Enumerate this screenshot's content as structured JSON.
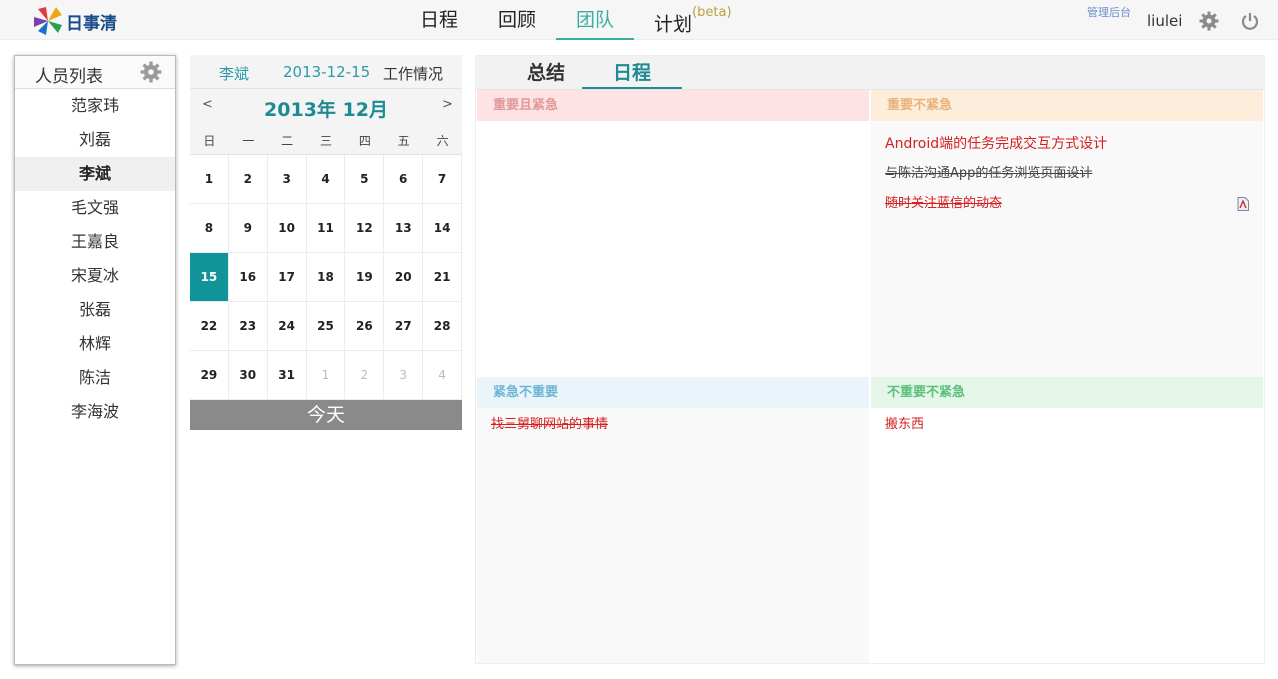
{
  "brand": {
    "logo_text": "日事清"
  },
  "nav": {
    "items": [
      {
        "label": "日程"
      },
      {
        "label": "回顾"
      },
      {
        "label": "团队"
      },
      {
        "label": "计划"
      }
    ],
    "beta_label": "(beta)",
    "active_index": 2
  },
  "user": {
    "admin_link": "管理后台",
    "username": "liulei"
  },
  "people": {
    "title": "人员列表",
    "members": [
      "范家玮",
      "刘磊",
      "李斌",
      "毛文强",
      "王嘉良",
      "宋夏冰",
      "张磊",
      "林辉",
      "陈洁",
      "李海波"
    ],
    "selected": "李斌"
  },
  "calendar": {
    "person": "李斌",
    "date": "2013-12-15",
    "work_label": "工作情况",
    "prev": "<",
    "next": ">",
    "month_label": "2013年 12月",
    "weekdays": [
      "日",
      "一",
      "二",
      "三",
      "四",
      "五",
      "六"
    ],
    "days": [
      "1",
      "2",
      "3",
      "4",
      "5",
      "6",
      "7",
      "8",
      "9",
      "10",
      "11",
      "12",
      "13",
      "14",
      "15",
      "16",
      "17",
      "18",
      "19",
      "20",
      "21",
      "22",
      "23",
      "24",
      "25",
      "26",
      "27",
      "28",
      "29",
      "30",
      "31",
      "1",
      "2",
      "3",
      "4"
    ],
    "selected_day": "15",
    "today_button": "今天"
  },
  "panel": {
    "tabs": {
      "summary": "总结",
      "schedule": "日程"
    },
    "quadrants": {
      "important_urgent": {
        "title": "重要且紧急",
        "tasks": []
      },
      "important_not_urgent": {
        "title": "重要不紧急",
        "tasks": [
          {
            "text": "Android端的任务完成交互方式设计"
          },
          {
            "text": "与陈洁沟通App的任务浏览页面设计"
          },
          {
            "text": "随时关注蓝信的动态"
          }
        ]
      },
      "urgent_not_important": {
        "title": "紧急不重要",
        "tasks": [
          {
            "text": "找三舅聊网站的事情"
          }
        ]
      },
      "not_important_not_urgent": {
        "title": "不重要不紧急",
        "tasks": [
          {
            "text": "搬东西"
          }
        ]
      }
    }
  },
  "colors": {
    "accent": "#10949a",
    "nav_active": "#3aaf9f",
    "task_red": "#d42020"
  }
}
